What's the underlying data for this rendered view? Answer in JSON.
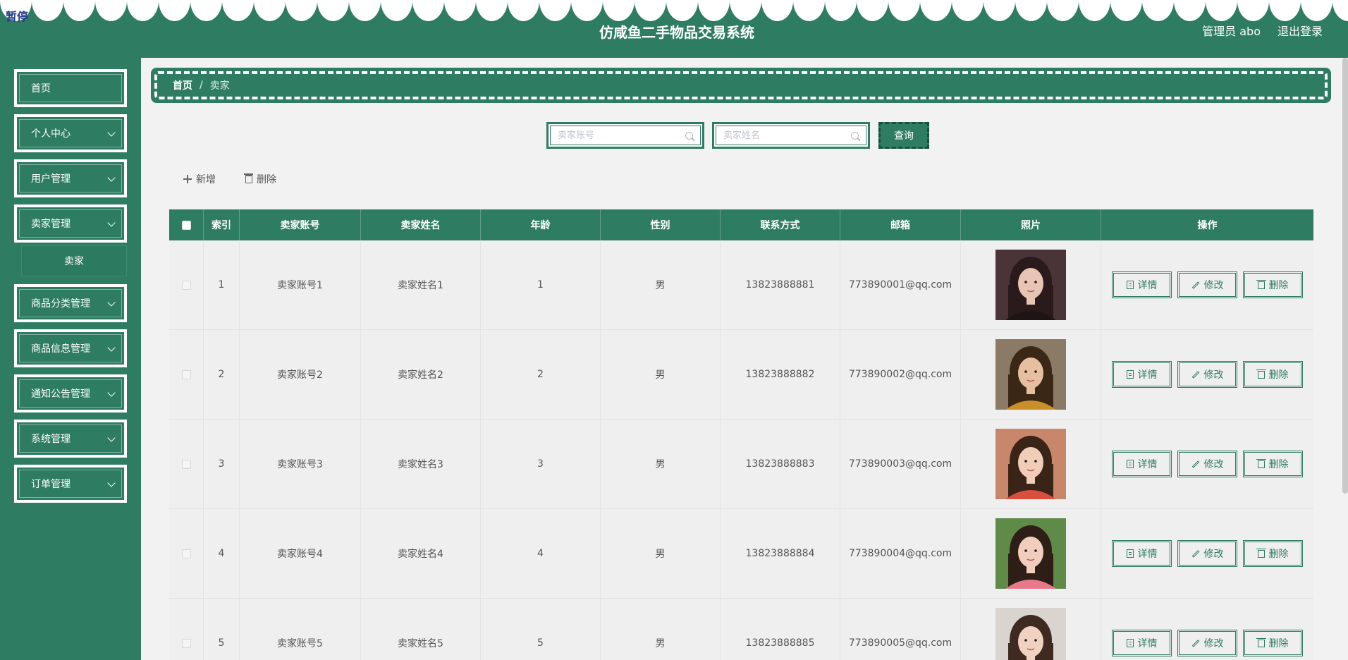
{
  "header": {
    "overlay_label": "暂停",
    "title": "仿咸鱼二手物品交易系统",
    "user_label": "管理员 abo",
    "logout_label": "退出登录"
  },
  "sidebar": {
    "items": [
      {
        "label": "首页",
        "has_arrow": false
      },
      {
        "label": "个人中心",
        "has_arrow": true
      },
      {
        "label": "用户管理",
        "has_arrow": true
      },
      {
        "label": "卖家管理",
        "has_arrow": true
      },
      {
        "label": "商品分类管理",
        "has_arrow": true
      },
      {
        "label": "商品信息管理",
        "has_arrow": true
      },
      {
        "label": "通知公告管理",
        "has_arrow": true
      },
      {
        "label": "系统管理",
        "has_arrow": true
      },
      {
        "label": "订单管理",
        "has_arrow": true
      }
    ],
    "submenu": {
      "label": "卖家"
    }
  },
  "breadcrumb": {
    "home": "首页",
    "separator": "/",
    "current": "卖家"
  },
  "search": {
    "account_placeholder": "卖家账号",
    "name_placeholder": "卖家姓名",
    "query_label": "查询"
  },
  "toolbar": {
    "add_label": "新增",
    "delete_label": "删除"
  },
  "table": {
    "columns": [
      "",
      "索引",
      "卖家账号",
      "卖家姓名",
      "年龄",
      "性别",
      "联系方式",
      "邮箱",
      "照片",
      "操作"
    ],
    "rows": [
      {
        "index": "1",
        "account": "卖家账号1",
        "name": "卖家姓名1",
        "age": "1",
        "gender": "男",
        "phone": "13823888881",
        "email": "773890001@qq.com"
      },
      {
        "index": "2",
        "account": "卖家账号2",
        "name": "卖家姓名2",
        "age": "2",
        "gender": "男",
        "phone": "13823888882",
        "email": "773890002@qq.com"
      },
      {
        "index": "3",
        "account": "卖家账号3",
        "name": "卖家姓名3",
        "age": "3",
        "gender": "男",
        "phone": "13823888883",
        "email": "773890003@qq.com"
      },
      {
        "index": "4",
        "account": "卖家账号4",
        "name": "卖家姓名4",
        "age": "4",
        "gender": "男",
        "phone": "13823888884",
        "email": "773890004@qq.com"
      },
      {
        "index": "5",
        "account": "卖家账号5",
        "name": "卖家姓名5",
        "age": "5",
        "gender": "男",
        "phone": "13823888885",
        "email": "773890005@qq.com"
      }
    ],
    "actions": {
      "detail": "详情",
      "edit": "修改",
      "delete": "删除"
    }
  },
  "colors": {
    "primary": "#2e7d62",
    "background": "#f2f2f2"
  },
  "icons": [
    "search-icon",
    "plus-icon",
    "trash-icon",
    "document-icon",
    "edit-icon",
    "chevron-down-icon"
  ]
}
